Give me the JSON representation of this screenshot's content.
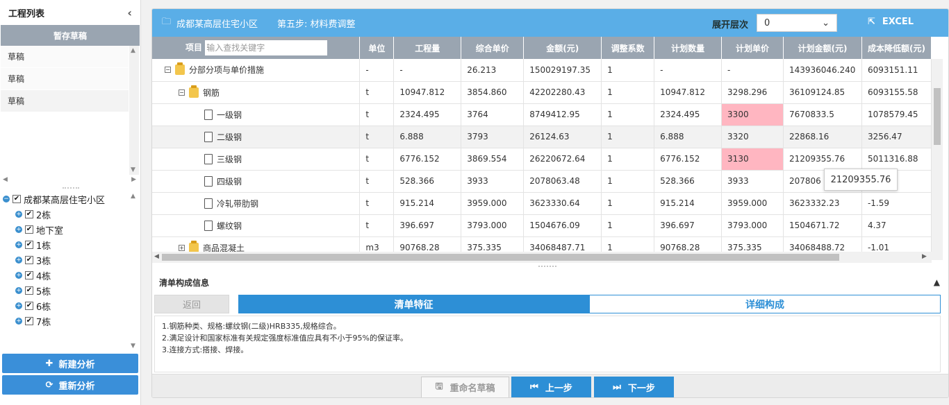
{
  "left": {
    "title": "工程列表",
    "collapse_icon": "chevron-left-icon",
    "draft_header": "暂存草稿",
    "drafts": [
      "草稿",
      "草稿",
      "草稿"
    ],
    "tree": {
      "root": "成都某高层住宅小区",
      "children": [
        "2栋",
        "地下室",
        "1栋",
        "3栋",
        "4栋",
        "5栋",
        "6栋",
        "7栋"
      ]
    },
    "new_analysis": "新建分析",
    "re_analysis": "重新分析"
  },
  "topbar": {
    "project": "成都某高层住宅小区",
    "step": "第五步: 材料费调整",
    "level_label": "展开层次",
    "level_value": "0",
    "excel": "EXCEL"
  },
  "grid": {
    "search_placeholder": "输入查找关键字",
    "columns": [
      "项目",
      "单位",
      "工程量",
      "综合单价",
      "金额(元)",
      "调整系数",
      "计划数量",
      "计划单价",
      "计划金额(元)",
      "成本降低额(元)"
    ],
    "rows": [
      {
        "name": "分部分项与单价措施",
        "unit": "-",
        "qty": "-",
        "price": "26.213",
        "amount": "150029197.35",
        "coef": "1",
        "plan_qty": "-",
        "plan_price": "-",
        "plan_amount": "143936046.240",
        "saving": "6093151.11"
      },
      {
        "name": "钢筋",
        "unit": "t",
        "qty": "10947.812",
        "price": "3854.860",
        "amount": "42202280.43",
        "coef": "1",
        "plan_qty": "10947.812",
        "plan_price": "3298.296",
        "plan_amount": "36109124.85",
        "saving": "6093155.58"
      },
      {
        "name": "一级钢",
        "unit": "t",
        "qty": "2324.495",
        "price": "3764",
        "amount": "8749412.95",
        "coef": "1",
        "plan_qty": "2324.495",
        "plan_price": "3300",
        "plan_amount": "7670833.5",
        "saving": "1078579.45"
      },
      {
        "name": "二级钢",
        "unit": "t",
        "qty": "6.888",
        "price": "3793",
        "amount": "26124.63",
        "coef": "1",
        "plan_qty": "6.888",
        "plan_price": "3320",
        "plan_amount": "22868.16",
        "saving": "3256.47"
      },
      {
        "name": "三级钢",
        "unit": "t",
        "qty": "6776.152",
        "price": "3869.554",
        "amount": "26220672.64",
        "coef": "1",
        "plan_qty": "6776.152",
        "plan_price": "3130",
        "plan_amount": "21209355.76",
        "saving": "5011316.88"
      },
      {
        "name": "四级钢",
        "unit": "t",
        "qty": "528.366",
        "price": "3933",
        "amount": "2078063.48",
        "coef": "1",
        "plan_qty": "528.366",
        "plan_price": "3933",
        "plan_amount": "207806",
        "saving": ""
      },
      {
        "name": "冷轧带肋钢",
        "unit": "t",
        "qty": "915.214",
        "price": "3959.000",
        "amount": "3623330.64",
        "coef": "1",
        "plan_qty": "915.214",
        "plan_price": "3959.000",
        "plan_amount": "3623332.23",
        "saving": "-1.59"
      },
      {
        "name": "螺纹钢",
        "unit": "t",
        "qty": "396.697",
        "price": "3793.000",
        "amount": "1504676.09",
        "coef": "1",
        "plan_qty": "396.697",
        "plan_price": "3793.000",
        "plan_amount": "1504671.72",
        "saving": "4.37"
      },
      {
        "name": "商品混凝土",
        "unit": "m3",
        "qty": "90768.28",
        "price": "375.335",
        "amount": "34068487.71",
        "coef": "1",
        "plan_qty": "90768.28",
        "plan_price": "375.335",
        "plan_amount": "34068488.72",
        "saving": "-1.01"
      }
    ],
    "tooltip": "21209355.76"
  },
  "info": {
    "title": "清单构成信息",
    "back": "返回",
    "tab_feature": "清单特征",
    "tab_detail": "详细构成",
    "lines": [
      "1.钢筋种类、规格:螺纹钢(二级)HRB335,规格综合。",
      "2.满足设计和国家标准有关规定强度标准值应具有不小于95%的保证率。",
      "3.连接方式:搭接、焊接。"
    ]
  },
  "footer": {
    "rename": "重命名草稿",
    "prev": "上一步",
    "next": "下一步"
  },
  "colors": {
    "accent": "#2d8fd6",
    "topbar": "#5aaee7",
    "header": "#9aa5b1",
    "highlight": "#ffb6c1"
  }
}
